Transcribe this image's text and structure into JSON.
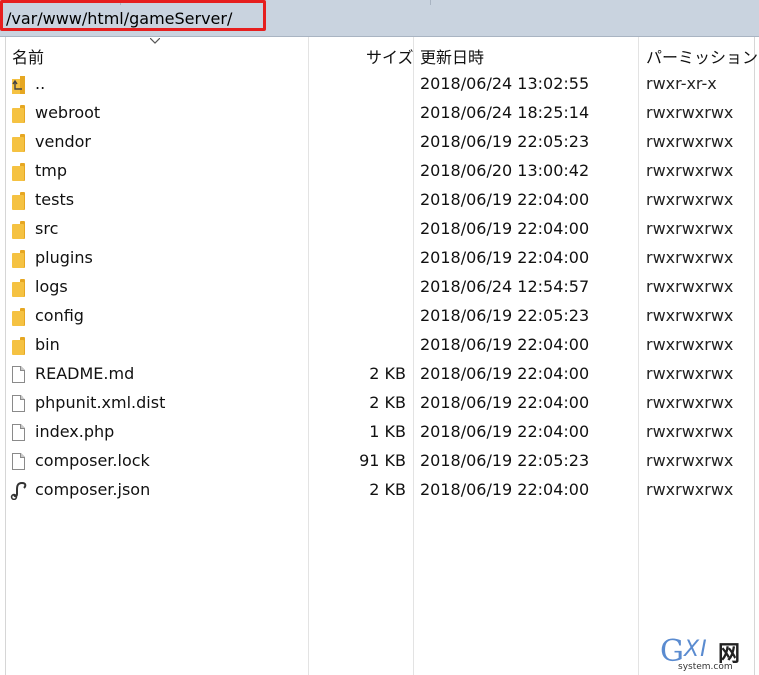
{
  "path": {
    "current": "/var/www/html/gameServer/"
  },
  "columns": {
    "name": "名前",
    "size": "サイズ",
    "modified": "更新日時",
    "permissions": "パーミッション"
  },
  "files": [
    {
      "icon": "parent-dir-icon",
      "name": "..",
      "size": "",
      "modified": "2018/06/24 13:02:55",
      "permissions": "rwxr-xr-x"
    },
    {
      "icon": "folder-icon",
      "name": "webroot",
      "size": "",
      "modified": "2018/06/24 18:25:14",
      "permissions": "rwxrwxrwx"
    },
    {
      "icon": "folder-icon",
      "name": "vendor",
      "size": "",
      "modified": "2018/06/19 22:05:23",
      "permissions": "rwxrwxrwx"
    },
    {
      "icon": "folder-icon",
      "name": "tmp",
      "size": "",
      "modified": "2018/06/20 13:00:42",
      "permissions": "rwxrwxrwx"
    },
    {
      "icon": "folder-icon",
      "name": "tests",
      "size": "",
      "modified": "2018/06/19 22:04:00",
      "permissions": "rwxrwxrwx"
    },
    {
      "icon": "folder-icon",
      "name": "src",
      "size": "",
      "modified": "2018/06/19 22:04:00",
      "permissions": "rwxrwxrwx"
    },
    {
      "icon": "folder-icon",
      "name": "plugins",
      "size": "",
      "modified": "2018/06/19 22:04:00",
      "permissions": "rwxrwxrwx"
    },
    {
      "icon": "folder-icon",
      "name": "logs",
      "size": "",
      "modified": "2018/06/24 12:54:57",
      "permissions": "rwxrwxrwx"
    },
    {
      "icon": "folder-icon",
      "name": "config",
      "size": "",
      "modified": "2018/06/19 22:05:23",
      "permissions": "rwxrwxrwx"
    },
    {
      "icon": "folder-icon",
      "name": "bin",
      "size": "",
      "modified": "2018/06/19 22:04:00",
      "permissions": "rwxrwxrwx"
    },
    {
      "icon": "file-icon",
      "name": "README.md",
      "size": "2 KB",
      "modified": "2018/06/19 22:04:00",
      "permissions": "rwxrwxrwx"
    },
    {
      "icon": "file-icon",
      "name": "phpunit.xml.dist",
      "size": "2 KB",
      "modified": "2018/06/19 22:04:00",
      "permissions": "rwxrwxrwx"
    },
    {
      "icon": "file-icon",
      "name": "index.php",
      "size": "1 KB",
      "modified": "2018/06/19 22:04:00",
      "permissions": "rwxrwxrwx"
    },
    {
      "icon": "file-icon",
      "name": "composer.lock",
      "size": "91 KB",
      "modified": "2018/06/19 22:05:23",
      "permissions": "rwxrwxrwx"
    },
    {
      "icon": "json-file-icon",
      "name": "composer.json",
      "size": "2 KB",
      "modified": "2018/06/19 22:04:00",
      "permissions": "rwxrwxrwx"
    }
  ],
  "watermark": {
    "mark": "G",
    "letters": "XI",
    "suffix": "网",
    "domain": "system.com"
  },
  "colors": {
    "pathbar": "#c9d3df",
    "highlight": "#e61e1e",
    "folder": "#f5c242"
  }
}
